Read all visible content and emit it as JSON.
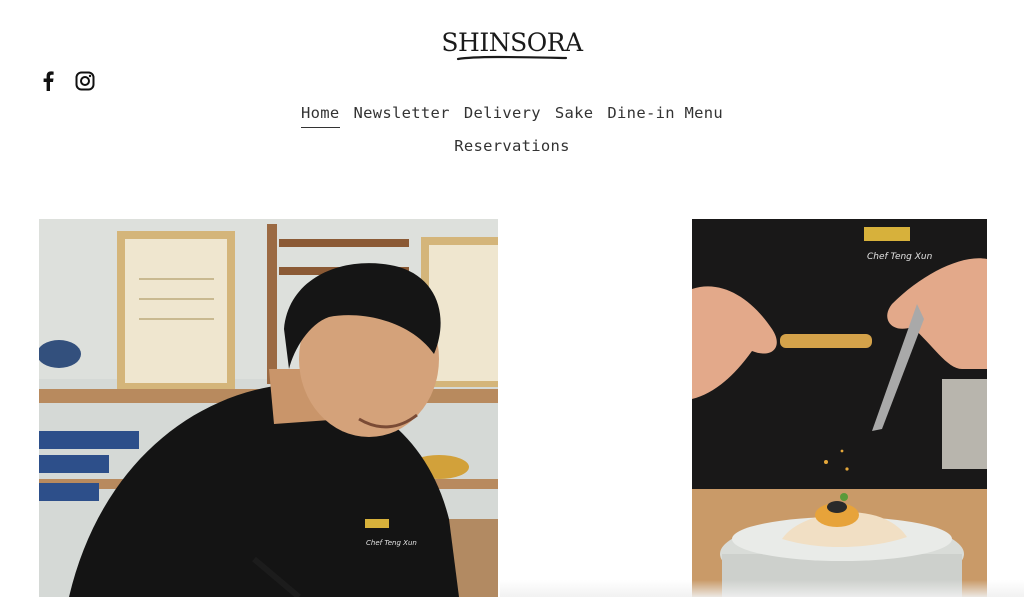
{
  "brand": {
    "name": "SHINSORA"
  },
  "social": [
    {
      "icon": "facebook-icon"
    },
    {
      "icon": "instagram-icon"
    }
  ],
  "nav": {
    "active": "Home",
    "items": [
      {
        "label": "Home"
      },
      {
        "label": "Newsletter"
      },
      {
        "label": "Delivery"
      },
      {
        "label": "Sake"
      },
      {
        "label": "Dine-in Menu"
      },
      {
        "label": "Reservations"
      }
    ]
  },
  "gallery": {
    "left_photo": {
      "embroidery": "Chef Teng Xun"
    },
    "right_photo": {
      "embroidery": "Chef Teng Xun"
    }
  }
}
